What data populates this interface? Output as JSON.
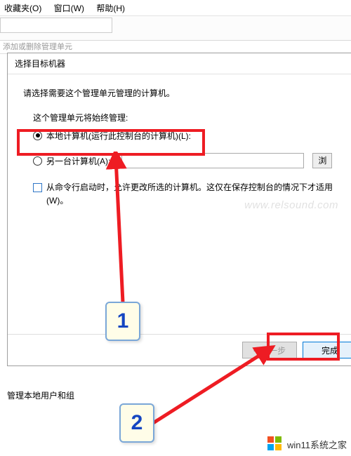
{
  "menubar": {
    "favorites": "收藏夹(O)",
    "window": "窗口(W)",
    "help": "帮助(H)"
  },
  "breadcrumb_hint": "添加或删除管理单元",
  "dialog": {
    "title": "选择目标机器",
    "prompt": "请选择需要这个管理单元管理的计算机。",
    "sub_label": "这个管理单元将始终管理:",
    "radio_local": "本地计算机(运行此控制台的计算机)(L):",
    "radio_remote": "另一台计算机(A):",
    "remote_value": "",
    "browse_char": "浏",
    "checkbox_label": "从命令行启动时，允许更改所选的计算机。这仅在保存控制台的情况下才适用(W)。",
    "btn_back": "< 上一步",
    "btn_finish": "完成"
  },
  "bottom_section": "管理本地用户和组",
  "annotations": {
    "step1": "1",
    "step2": "2"
  },
  "watermark_mid": "www.relsound.com",
  "watermark_brand": "win11系统之家"
}
